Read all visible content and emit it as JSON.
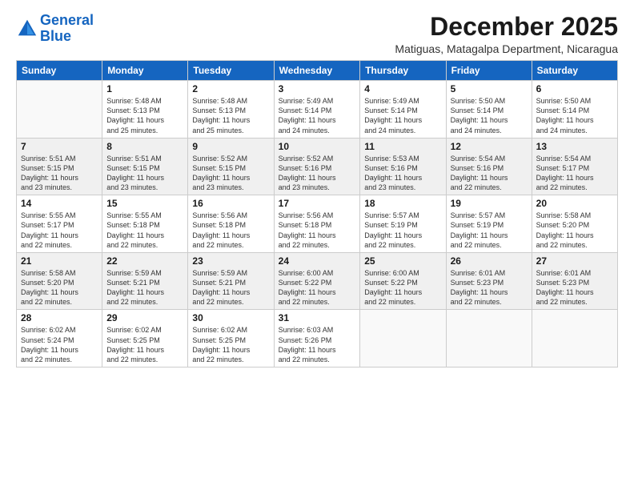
{
  "logo": {
    "line1": "General",
    "line2": "Blue"
  },
  "title": "December 2025",
  "subtitle": "Matiguas, Matagalpa Department, Nicaragua",
  "weekdays": [
    "Sunday",
    "Monday",
    "Tuesday",
    "Wednesday",
    "Thursday",
    "Friday",
    "Saturday"
  ],
  "weeks": [
    [
      {
        "day": "",
        "content": ""
      },
      {
        "day": "1",
        "content": "Sunrise: 5:48 AM\nSunset: 5:13 PM\nDaylight: 11 hours\nand 25 minutes."
      },
      {
        "day": "2",
        "content": "Sunrise: 5:48 AM\nSunset: 5:13 PM\nDaylight: 11 hours\nand 25 minutes."
      },
      {
        "day": "3",
        "content": "Sunrise: 5:49 AM\nSunset: 5:14 PM\nDaylight: 11 hours\nand 24 minutes."
      },
      {
        "day": "4",
        "content": "Sunrise: 5:49 AM\nSunset: 5:14 PM\nDaylight: 11 hours\nand 24 minutes."
      },
      {
        "day": "5",
        "content": "Sunrise: 5:50 AM\nSunset: 5:14 PM\nDaylight: 11 hours\nand 24 minutes."
      },
      {
        "day": "6",
        "content": "Sunrise: 5:50 AM\nSunset: 5:14 PM\nDaylight: 11 hours\nand 24 minutes."
      }
    ],
    [
      {
        "day": "7",
        "content": "Sunrise: 5:51 AM\nSunset: 5:15 PM\nDaylight: 11 hours\nand 23 minutes."
      },
      {
        "day": "8",
        "content": "Sunrise: 5:51 AM\nSunset: 5:15 PM\nDaylight: 11 hours\nand 23 minutes."
      },
      {
        "day": "9",
        "content": "Sunrise: 5:52 AM\nSunset: 5:15 PM\nDaylight: 11 hours\nand 23 minutes."
      },
      {
        "day": "10",
        "content": "Sunrise: 5:52 AM\nSunset: 5:16 PM\nDaylight: 11 hours\nand 23 minutes."
      },
      {
        "day": "11",
        "content": "Sunrise: 5:53 AM\nSunset: 5:16 PM\nDaylight: 11 hours\nand 23 minutes."
      },
      {
        "day": "12",
        "content": "Sunrise: 5:54 AM\nSunset: 5:16 PM\nDaylight: 11 hours\nand 22 minutes."
      },
      {
        "day": "13",
        "content": "Sunrise: 5:54 AM\nSunset: 5:17 PM\nDaylight: 11 hours\nand 22 minutes."
      }
    ],
    [
      {
        "day": "14",
        "content": "Sunrise: 5:55 AM\nSunset: 5:17 PM\nDaylight: 11 hours\nand 22 minutes."
      },
      {
        "day": "15",
        "content": "Sunrise: 5:55 AM\nSunset: 5:18 PM\nDaylight: 11 hours\nand 22 minutes."
      },
      {
        "day": "16",
        "content": "Sunrise: 5:56 AM\nSunset: 5:18 PM\nDaylight: 11 hours\nand 22 minutes."
      },
      {
        "day": "17",
        "content": "Sunrise: 5:56 AM\nSunset: 5:18 PM\nDaylight: 11 hours\nand 22 minutes."
      },
      {
        "day": "18",
        "content": "Sunrise: 5:57 AM\nSunset: 5:19 PM\nDaylight: 11 hours\nand 22 minutes."
      },
      {
        "day": "19",
        "content": "Sunrise: 5:57 AM\nSunset: 5:19 PM\nDaylight: 11 hours\nand 22 minutes."
      },
      {
        "day": "20",
        "content": "Sunrise: 5:58 AM\nSunset: 5:20 PM\nDaylight: 11 hours\nand 22 minutes."
      }
    ],
    [
      {
        "day": "21",
        "content": "Sunrise: 5:58 AM\nSunset: 5:20 PM\nDaylight: 11 hours\nand 22 minutes."
      },
      {
        "day": "22",
        "content": "Sunrise: 5:59 AM\nSunset: 5:21 PM\nDaylight: 11 hours\nand 22 minutes."
      },
      {
        "day": "23",
        "content": "Sunrise: 5:59 AM\nSunset: 5:21 PM\nDaylight: 11 hours\nand 22 minutes."
      },
      {
        "day": "24",
        "content": "Sunrise: 6:00 AM\nSunset: 5:22 PM\nDaylight: 11 hours\nand 22 minutes."
      },
      {
        "day": "25",
        "content": "Sunrise: 6:00 AM\nSunset: 5:22 PM\nDaylight: 11 hours\nand 22 minutes."
      },
      {
        "day": "26",
        "content": "Sunrise: 6:01 AM\nSunset: 5:23 PM\nDaylight: 11 hours\nand 22 minutes."
      },
      {
        "day": "27",
        "content": "Sunrise: 6:01 AM\nSunset: 5:23 PM\nDaylight: 11 hours\nand 22 minutes."
      }
    ],
    [
      {
        "day": "28",
        "content": "Sunrise: 6:02 AM\nSunset: 5:24 PM\nDaylight: 11 hours\nand 22 minutes."
      },
      {
        "day": "29",
        "content": "Sunrise: 6:02 AM\nSunset: 5:25 PM\nDaylight: 11 hours\nand 22 minutes."
      },
      {
        "day": "30",
        "content": "Sunrise: 6:02 AM\nSunset: 5:25 PM\nDaylight: 11 hours\nand 22 minutes."
      },
      {
        "day": "31",
        "content": "Sunrise: 6:03 AM\nSunset: 5:26 PM\nDaylight: 11 hours\nand 22 minutes."
      },
      {
        "day": "",
        "content": ""
      },
      {
        "day": "",
        "content": ""
      },
      {
        "day": "",
        "content": ""
      }
    ]
  ]
}
